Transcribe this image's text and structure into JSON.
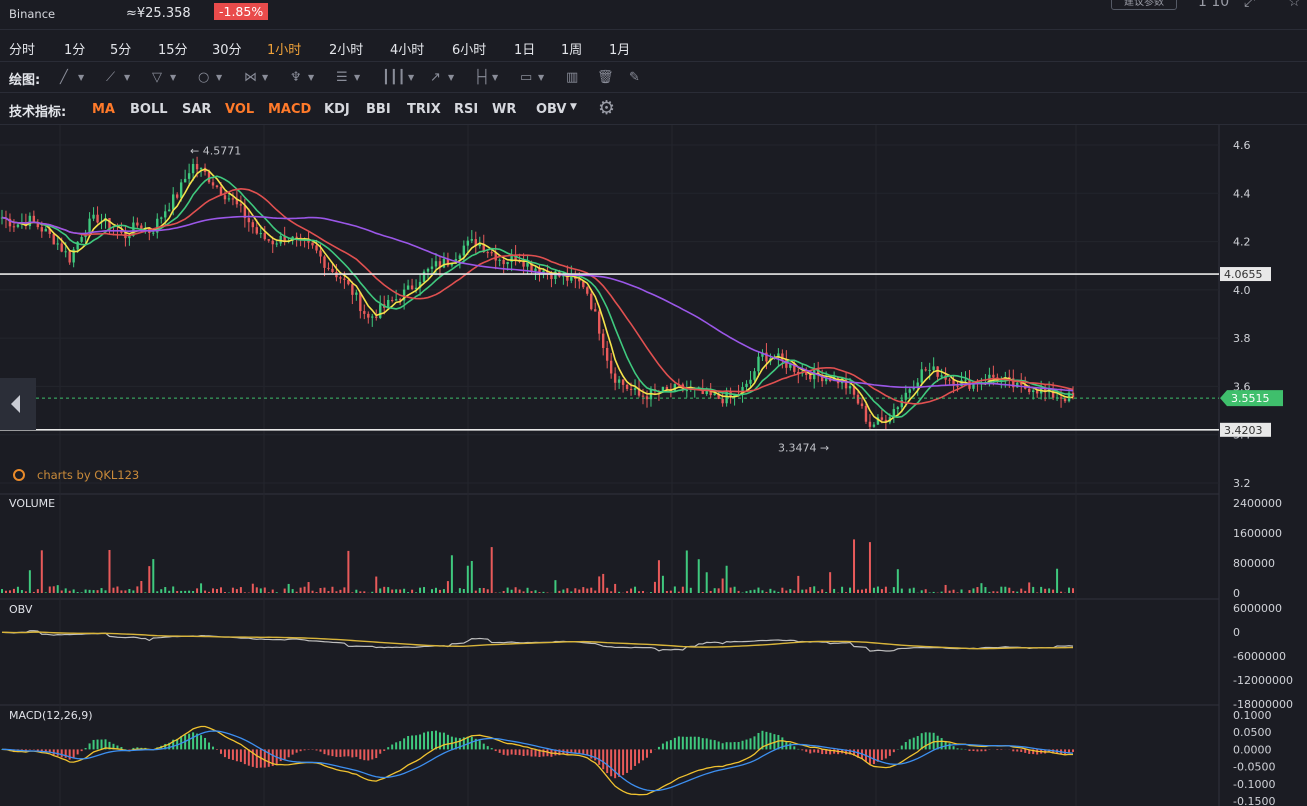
{
  "header": {
    "exchange": "Binance",
    "price": "≈¥25.358",
    "change": "-1.85%",
    "change_color": "#e94b4b",
    "right_button": "建议参数",
    "right_text": "1 10"
  },
  "periods": {
    "items": [
      "分时",
      "1分",
      "5分",
      "15分",
      "30分",
      "1小时",
      "2小时",
      "4小时",
      "6小时",
      "1日",
      "1周",
      "1月"
    ],
    "active": "1小时"
  },
  "draw_tools": {
    "label": "绘图:",
    "icons": [
      "line-tool-icon",
      "ray-tool-icon",
      "channel-tool-icon",
      "shape-tool-icon",
      "pattern-tool-icon",
      "fork-tool-icon",
      "fibonacci-tool-icon",
      "gann-tool-icon",
      "arrow-tool-icon",
      "measure-tool-icon",
      "note-tool-icon",
      "bar-chart-icon",
      "trash-icon",
      "pen-icon"
    ]
  },
  "indicators": {
    "label": "技术指标:",
    "items": [
      {
        "name": "MA",
        "on": true
      },
      {
        "name": "BOLL",
        "on": false
      },
      {
        "name": "SAR",
        "on": false
      },
      {
        "name": "VOL",
        "on": true
      },
      {
        "name": "MACD",
        "on": true
      },
      {
        "name": "KDJ",
        "on": false
      },
      {
        "name": "BBI",
        "on": false
      },
      {
        "name": "TRIX",
        "on": false
      },
      {
        "name": "RSI",
        "on": false
      },
      {
        "name": "WR",
        "on": false
      },
      {
        "name": "OBV",
        "on": false
      }
    ],
    "settings_icon": "gear-icon"
  },
  "watermark": "charts by QKL123",
  "chart_data": {
    "type": "candlestick",
    "price_axis": {
      "ticks": [
        "4.6",
        "4.4",
        "4.2",
        "4.0",
        "3.8",
        "3.6",
        "3.4",
        "3.2"
      ],
      "range": [
        3.2,
        4.6
      ]
    },
    "high_label": "← 4.5771",
    "low_label": "3.3474 →",
    "horizontal_lines": [
      {
        "label": "4.0655",
        "value": 4.0655,
        "color": "#e8e8e8"
      },
      {
        "label": "3.4203",
        "value": 3.4203,
        "color": "#e8e8e8"
      }
    ],
    "last_price": {
      "label": "3.5515",
      "value": 3.5515,
      "color": "#3fbf6c"
    },
    "price_path": [
      4.3,
      4.27,
      4.29,
      4.25,
      4.2,
      4.13,
      4.25,
      4.3,
      4.26,
      4.22,
      4.27,
      4.24,
      4.33,
      4.4,
      4.52,
      4.48,
      4.42,
      4.37,
      4.3,
      4.22,
      4.2,
      4.22,
      4.19,
      4.17,
      4.1,
      4.05,
      3.98,
      3.88,
      3.92,
      3.96,
      4.0,
      4.06,
      4.1,
      4.12,
      4.18,
      4.2,
      4.16,
      4.12,
      4.14,
      4.1,
      4.08,
      4.06,
      4.04,
      4.02,
      3.85,
      3.65,
      3.6,
      3.56,
      3.57,
      3.58,
      3.59,
      3.58,
      3.56,
      3.55,
      3.56,
      3.6,
      3.73,
      3.72,
      3.69,
      3.66,
      3.65,
      3.64,
      3.62,
      3.55,
      3.44,
      3.46,
      3.52,
      3.6,
      3.67,
      3.66,
      3.63,
      3.61,
      3.62,
      3.64,
      3.62,
      3.59,
      3.6,
      3.57,
      3.56,
      3.55
    ],
    "volume": {
      "title": "VOLUME",
      "ticks": [
        "2400000",
        "1600000",
        "800000",
        "0"
      ],
      "range": [
        0,
        2400000
      ]
    },
    "obv": {
      "title": "OBV",
      "ticks": [
        "6000000",
        "0",
        "-6000000",
        "-12000000",
        "-18000000"
      ],
      "range": [
        -18000000,
        6000000
      ]
    },
    "macd": {
      "title": "MACD(12,26,9)",
      "ticks": [
        "0.1000",
        "0.0500",
        "0.0000",
        "-0.0500",
        "-0.1000",
        "-0.1500"
      ],
      "range": [
        -0.15,
        0.1
      ]
    },
    "colors": {
      "up": "#3fc97e",
      "down": "#e85a5a",
      "ma5": "#f4e24b",
      "ma10": "#3fc97e",
      "ma20": "#e05050",
      "ma60": "#9b57e8",
      "dif": "#f0c230",
      "dea": "#3d8ff0",
      "obv": "#bfbfbf",
      "obvma": "#d8b43a"
    }
  }
}
